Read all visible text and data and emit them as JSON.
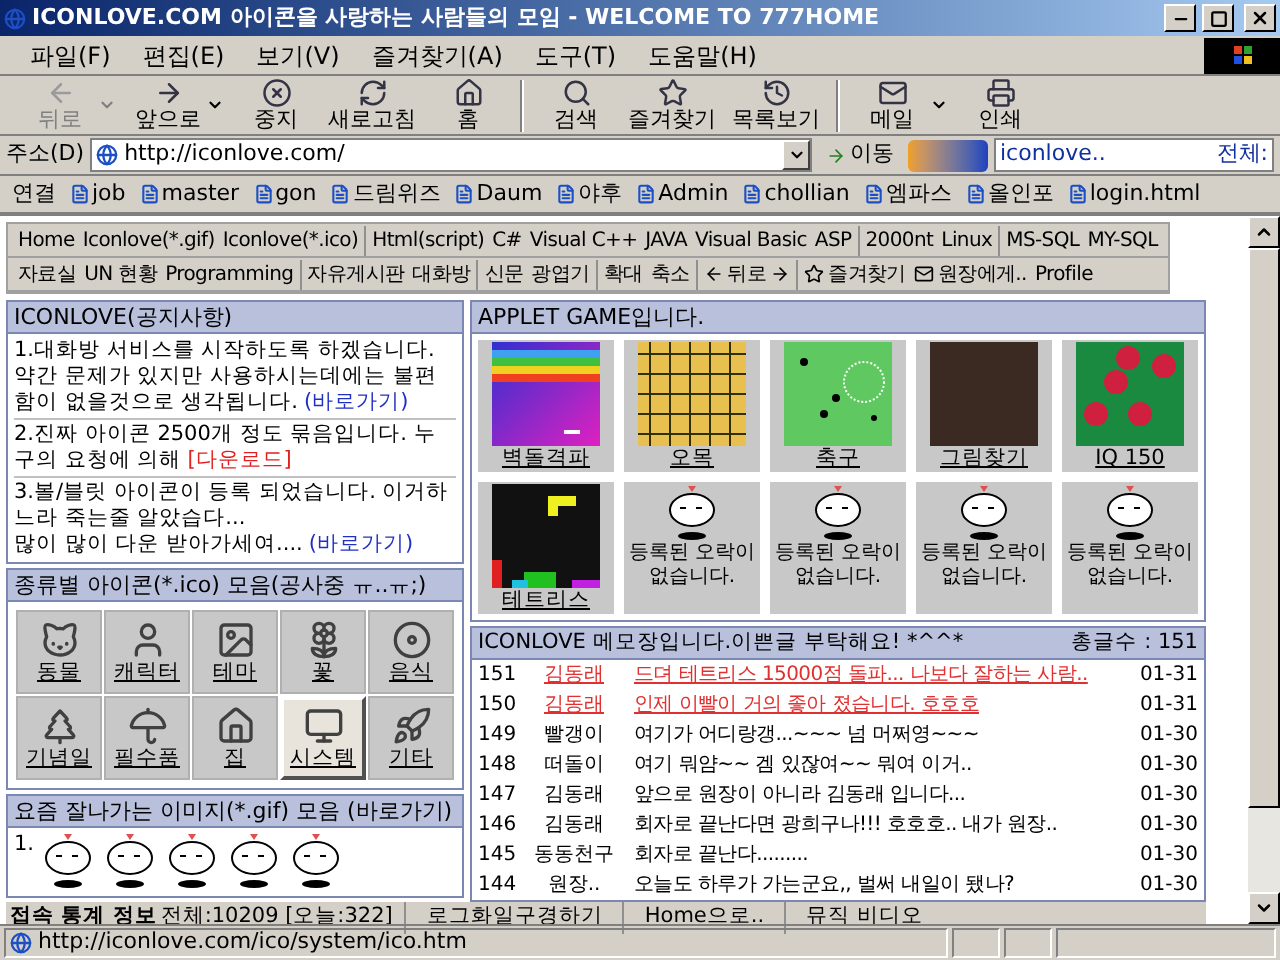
{
  "window": {
    "title": "ICONLOVE.COM 아이콘을 사랑하는 사람들의 모임 - WELCOME TO 777HOME"
  },
  "menu": [
    "파일(F)",
    "편집(E)",
    "보기(V)",
    "즐겨찾기(A)",
    "도구(T)",
    "도움말(H)"
  ],
  "toolbar": [
    [
      {
        "label": "뒤로",
        "disabled": true,
        "dropdown": true
      },
      {
        "label": "앞으로",
        "disabled": false,
        "dropdown": true
      },
      {
        "label": "중지",
        "disabled": false,
        "dropdown": false
      },
      {
        "label": "새로고침",
        "disabled": false,
        "dropdown": false
      },
      {
        "label": "홈",
        "disabled": false,
        "dropdown": false
      }
    ],
    [
      {
        "label": "검색",
        "disabled": false,
        "dropdown": false
      },
      {
        "label": "즐겨찾기",
        "disabled": false,
        "dropdown": false
      },
      {
        "label": "목록보기",
        "disabled": false,
        "dropdown": false
      }
    ],
    [
      {
        "label": "메일",
        "disabled": false,
        "dropdown": true
      },
      {
        "label": "인쇄",
        "disabled": false,
        "dropdown": false
      }
    ]
  ],
  "address": {
    "label": "주소(D)",
    "value": "http://iconlove.com/",
    "go": "이동",
    "search_value": "iconlove..",
    "search_scope": "전체:"
  },
  "links": {
    "label": "연결",
    "items": [
      "job",
      "master",
      "gon",
      "드림위즈",
      "Daum",
      "야후",
      "Admin",
      "chollian",
      "엠파스",
      "올인포",
      "login.html"
    ]
  },
  "nav": [
    [
      [
        {
          "label": "Home",
          "kind": "plain"
        },
        {
          "label": "Iconlove(*.gif)",
          "kind": "plain"
        },
        {
          "label": "Iconlove(*.ico)",
          "kind": "plain"
        }
      ],
      [
        {
          "label": "Html(script)",
          "kind": "plain"
        },
        {
          "label": "C#",
          "kind": "plain"
        },
        {
          "label": "Visual C++",
          "kind": "plain"
        },
        {
          "label": "JAVA",
          "kind": "plain"
        },
        {
          "label": "Visual Basic",
          "kind": "plain"
        },
        {
          "label": "ASP",
          "kind": "plain"
        }
      ],
      [
        {
          "label": "2000nt",
          "kind": "plain"
        },
        {
          "label": "Linux",
          "kind": "plain"
        }
      ],
      [
        {
          "label": "MS-SQL",
          "kind": "plain"
        },
        {
          "label": "MY-SQL",
          "kind": "plain"
        }
      ]
    ],
    [
      [
        {
          "label": "자료실",
          "kind": "plain"
        },
        {
          "label": "UN 현황",
          "kind": "plain"
        },
        {
          "label": "Programming",
          "kind": "plain"
        }
      ],
      [
        {
          "label": "자유게시판",
          "kind": "plain"
        },
        {
          "label": "대화방",
          "kind": "plain"
        }
      ],
      [
        {
          "label": "신문",
          "kind": "plain"
        },
        {
          "label": "광엽기",
          "kind": "plain"
        }
      ],
      [
        {
          "label": "확대",
          "kind": "plain"
        },
        {
          "label": "축소",
          "kind": "plain"
        }
      ],
      [
        {
          "label": "뒤로",
          "kind": "back"
        }
      ],
      [
        {
          "label": "즐겨찾기",
          "kind": "favorite"
        },
        {
          "label": "원장에게..",
          "kind": "mail"
        },
        {
          "label": "Profile",
          "kind": "plain"
        }
      ]
    ]
  ],
  "notice": {
    "title": "ICONLOVE(공지사항)",
    "items": [
      {
        "lines": [
          "1.대화방 서비스를 시작하도록 하겠습니다. 약간 문제가 있지만 사용하시는데에는 불편함이 없을것으로 생각됩니다."
        ],
        "link": "(바로가기)",
        "kind": "go"
      },
      {
        "lines": [
          "2.진짜 아이콘 2500개 정도 묶음입니다. 누구의 요청에 의해"
        ],
        "link": "[다운로드]",
        "kind": "download"
      },
      {
        "lines": [
          "3.볼/블릿 아이콘이 등록 되었습니다. 이거하느라 죽는줄 알았습다...",
          "많이 많이 다운 받아가세여...."
        ],
        "link": "(바로가기)",
        "kind": "go"
      }
    ]
  },
  "categories": {
    "title": "종류별 아이콘(*.ico) 모음(공사중 ㅠ..ㅠ;)",
    "items": [
      {
        "label": "동물",
        "selected": false
      },
      {
        "label": "캐릭터",
        "selected": false
      },
      {
        "label": "테마",
        "selected": false
      },
      {
        "label": "꽃",
        "selected": false
      },
      {
        "label": "음식",
        "selected": false
      },
      {
        "label": "기념일",
        "selected": false
      },
      {
        "label": "필수품",
        "selected": false
      },
      {
        "label": "집",
        "selected": false
      },
      {
        "label": "시스템",
        "selected": true
      },
      {
        "label": "기타",
        "selected": false
      }
    ]
  },
  "popular": {
    "title": "요즘 잘나가는 이미지(*.gif) 모음 (바로가기)",
    "number": "1."
  },
  "applet": {
    "title": "APPLET GAME입니다.",
    "games": [
      {
        "kind": "game",
        "label": "벽돌격파"
      },
      {
        "kind": "game",
        "label": "오목"
      },
      {
        "kind": "game",
        "label": "축구"
      },
      {
        "kind": "game",
        "label": "그림찾기"
      },
      {
        "kind": "game",
        "label": "IQ 150"
      },
      {
        "kind": "game",
        "label": "테트리스"
      },
      {
        "kind": "empty",
        "label": "등록된 오락이 없습니다."
      },
      {
        "kind": "empty",
        "label": "등록된 오락이 없습니다."
      },
      {
        "kind": "empty",
        "label": "등록된 오락이 없습니다."
      },
      {
        "kind": "empty",
        "label": "등록된 오락이 없습니다."
      }
    ]
  },
  "memo": {
    "title": "ICONLOVE 메모장입니다.이쁜글 부탁해요! *^^*",
    "count": "총글수 : 151",
    "rows": [
      {
        "no": "151",
        "name": "김동래",
        "text": "드뎌 테트리스 15000점 돌파... 나보다 잘하는 사람..",
        "date": "01-31",
        "highlighted": true
      },
      {
        "no": "150",
        "name": "김동래",
        "text": "인제 이빨이 거의 좋아 졌습니다. 호호호",
        "date": "01-31",
        "highlighted": true
      },
      {
        "no": "149",
        "name": "빨갱이",
        "text": "여기가 어디랑갱...~~~ 넘 머쩌영~~~",
        "date": "01-30",
        "highlighted": false
      },
      {
        "no": "148",
        "name": "떠돌이",
        "text": "여기 뭐얌~~ 겜 있잖여~~ 뭐여 이거..",
        "date": "01-30",
        "highlighted": false
      },
      {
        "no": "147",
        "name": "김동래",
        "text": "앞으로 원장이 아니라 김동래 입니다...",
        "date": "01-30",
        "highlighted": false
      },
      {
        "no": "146",
        "name": "김동래",
        "text": "회자로 끝난다면 광희구나!!! 호호호.. 내가 원장..",
        "date": "01-30",
        "highlighted": false
      },
      {
        "no": "145",
        "name": "동동천구",
        "text": "회자로 끝난다.........",
        "date": "01-30",
        "highlighted": false
      },
      {
        "no": "144",
        "name": "원장..",
        "text": "오늘도 하루가 가는군요,, 벌써 내일이 됐나?",
        "date": "01-30",
        "highlighted": false
      }
    ]
  },
  "footer": {
    "stats_label": "접속 통계 정보",
    "stats": "전체:10209 [오늘:322]",
    "links": [
      "로그화일구경하기",
      "Home으로..",
      "뮤직 비디오"
    ]
  },
  "status_bar": {
    "text": "http://iconlove.com/ico/system/ico.htm"
  }
}
